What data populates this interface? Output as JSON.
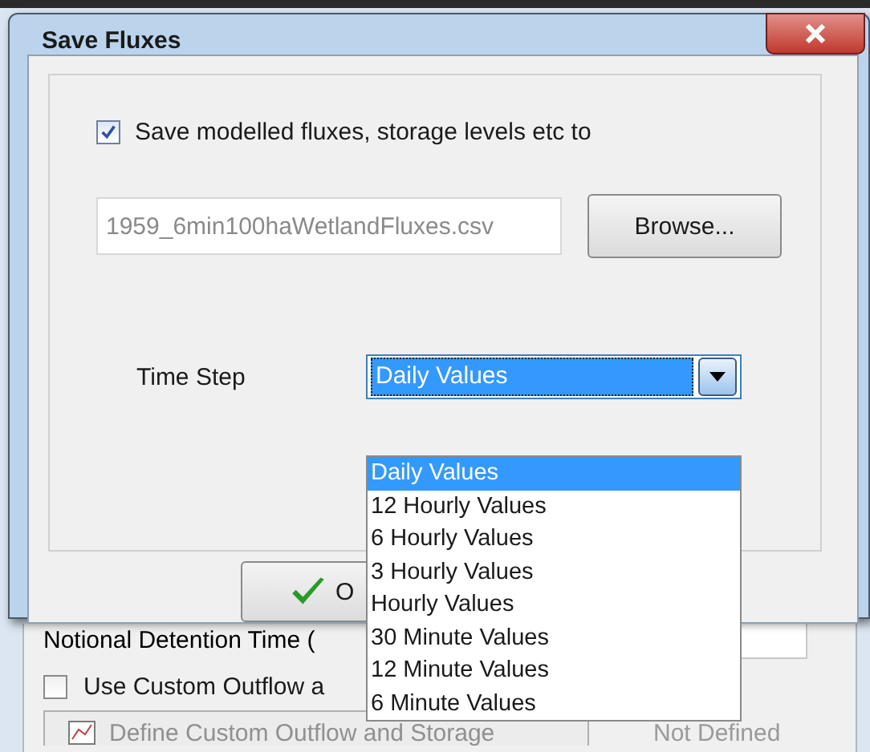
{
  "background_window": {
    "detention_label": "Notional Detention Time (",
    "custom_outflow": {
      "label": "Use Custom Outflow a",
      "checked": false
    },
    "define_button": "Define Custom Outflow and Storage",
    "status": "Not Defined"
  },
  "dialog": {
    "title": "Save Fluxes",
    "save_checkbox": {
      "label": "Save modelled fluxes, storage levels etc to",
      "checked": true
    },
    "file_field": {
      "value": "1959_6min100haWetlandFluxes.csv"
    },
    "browse_button": "Browse...",
    "time_step": {
      "label": "Time Step",
      "value": "Daily Values",
      "expanded": true,
      "options": [
        {
          "label": "Daily Values",
          "selected": true
        },
        {
          "label": "12 Hourly Values",
          "selected": false
        },
        {
          "label": "6 Hourly Values",
          "selected": false
        },
        {
          "label": "3 Hourly Values",
          "selected": false
        },
        {
          "label": "Hourly Values",
          "selected": false
        },
        {
          "label": "30 Minute Values",
          "selected": false
        },
        {
          "label": "12 Minute Values",
          "selected": false
        },
        {
          "label": "6 Minute Values",
          "selected": false
        }
      ]
    },
    "ok_button": "O"
  }
}
